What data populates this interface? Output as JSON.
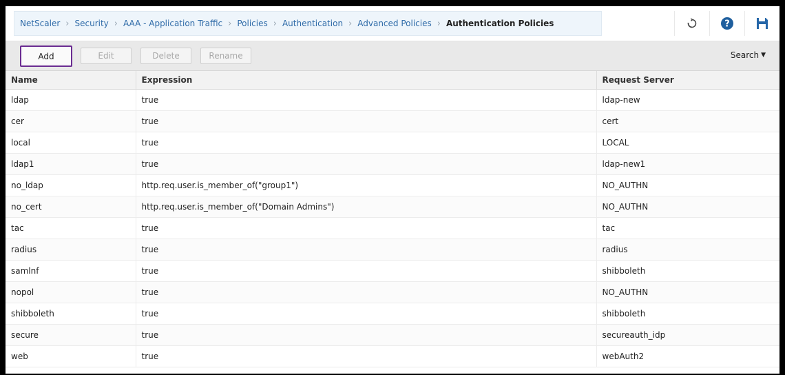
{
  "breadcrumb": [
    {
      "label": "NetScaler"
    },
    {
      "label": "Security"
    },
    {
      "label": "AAA - Application Traffic"
    },
    {
      "label": "Policies"
    },
    {
      "label": "Authentication"
    },
    {
      "label": "Advanced Policies"
    },
    {
      "label": "Authentication Policies"
    }
  ],
  "header_icons": [
    "refresh-icon",
    "help-icon",
    "save-icon"
  ],
  "colors": {
    "accent": "#6a2c91",
    "help": "#1f5f9e",
    "save": "#2566a8"
  },
  "toolbar": {
    "add_label": "Add",
    "edit_label": "Edit",
    "delete_label": "Delete",
    "rename_label": "Rename",
    "search_label": "Search"
  },
  "table": {
    "columns": [
      "Name",
      "Expression",
      "Request Server"
    ],
    "rows": [
      [
        "ldap",
        "true",
        "ldap-new"
      ],
      [
        "cer",
        "true",
        "cert"
      ],
      [
        "local",
        "true",
        "LOCAL"
      ],
      [
        "ldap1",
        "true",
        "ldap-new1"
      ],
      [
        "no_ldap",
        "http.req.user.is_member_of(\"group1\")",
        "NO_AUTHN"
      ],
      [
        "no_cert",
        "http.req.user.is_member_of(\"Domain Admins\")",
        "NO_AUTHN"
      ],
      [
        "tac",
        "true",
        "tac"
      ],
      [
        "radius",
        "true",
        "radius"
      ],
      [
        "samlnf",
        "true",
        "shibboleth"
      ],
      [
        "nopol",
        "true",
        "NO_AUTHN"
      ],
      [
        "shibboleth",
        "true",
        "shibboleth"
      ],
      [
        "secure",
        "true",
        "secureauth_idp"
      ],
      [
        "web",
        "true",
        "webAuth2"
      ]
    ]
  }
}
